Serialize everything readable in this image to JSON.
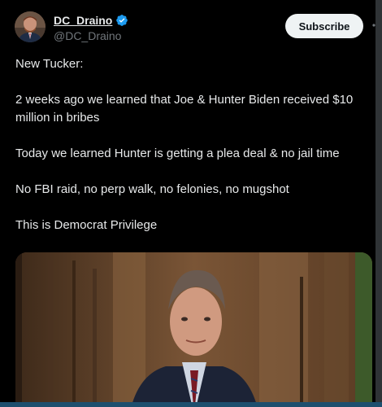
{
  "author": {
    "display_name": "DC_Draino",
    "handle": "@DC_Draino",
    "verified": true,
    "avatar_icon": "profile-photo"
  },
  "actions": {
    "subscribe_label": "Subscribe",
    "more_icon": "more-horizontal-icon"
  },
  "post": {
    "paragraphs": [
      "New Tucker:",
      "2 weeks ago we learned that Joe & Hunter Biden received $10 million in bribes",
      "Today we learned Hunter is getting a plea deal & no jail time",
      "No FBI raid, no perp walk, no felonies, no mugshot",
      "This is Democrat Privilege"
    ]
  },
  "media": {
    "type": "video-thumbnail"
  },
  "colors": {
    "background": "#000000",
    "text_primary": "#e7e9ea",
    "text_secondary": "#71767b",
    "verified_blue": "#1d9bf0",
    "subscribe_bg": "#eff3f4"
  }
}
